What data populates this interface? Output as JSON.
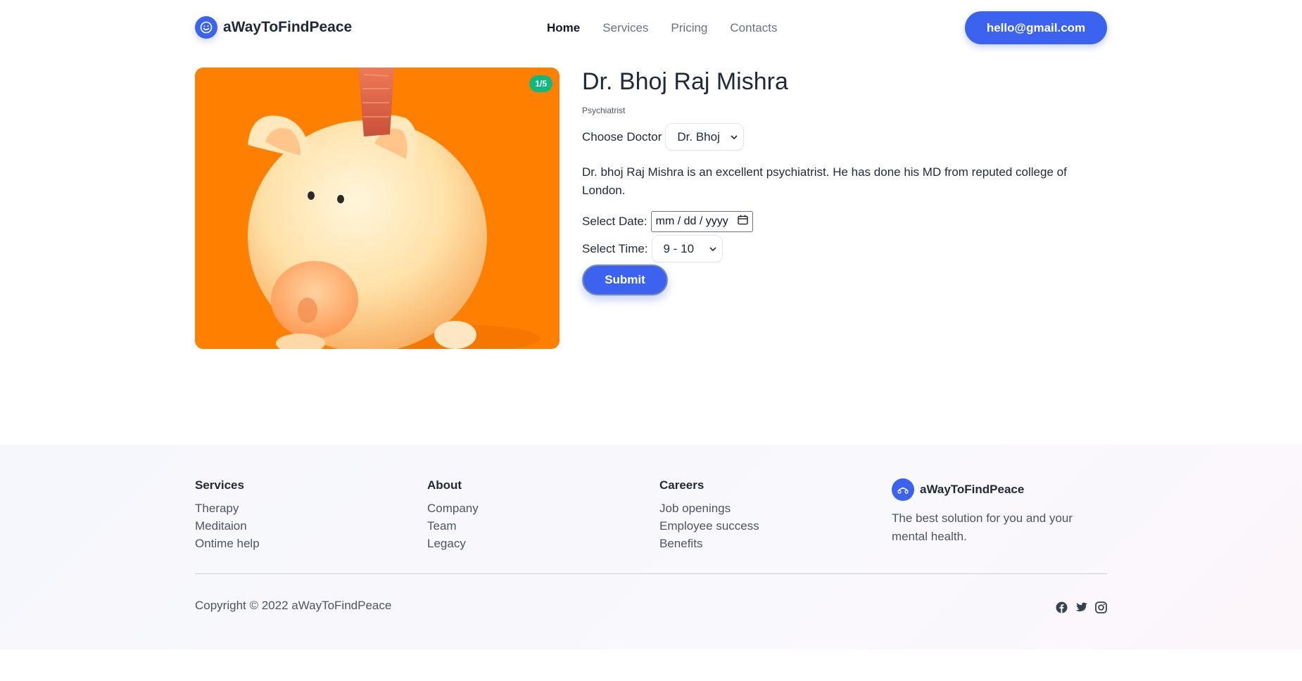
{
  "header": {
    "brand_name": "aWayToFindPeace",
    "nav": [
      {
        "label": "Home",
        "active": true
      },
      {
        "label": "Services",
        "active": false
      },
      {
        "label": "Pricing",
        "active": false
      },
      {
        "label": "Contacts",
        "active": false
      }
    ],
    "email_button": "hello@gmail.com"
  },
  "gallery": {
    "counter": "1/5",
    "image_subject": "piggy-bank"
  },
  "doctor": {
    "name": "Dr. Bhoj Raj Mishra",
    "role": "Psychiatrist",
    "choose_label": "Choose Doctor",
    "selected_doctor": "Dr. Bhoj",
    "description": "Dr. bhoj Raj Mishra is an excellent psychiatrist. He has done his MD from reputed college of London.",
    "date_label": "Select Date:",
    "date_placeholder": "mm / dd / yyyy",
    "time_label": "Select Time:",
    "selected_time": "9 - 10",
    "submit_label": "Submit"
  },
  "footer": {
    "columns": [
      {
        "title": "Services",
        "links": [
          "Therapy",
          "Meditaion",
          "Ontime help"
        ]
      },
      {
        "title": "About",
        "links": [
          "Company",
          "Team",
          "Legacy"
        ]
      },
      {
        "title": "Careers",
        "links": [
          "Job openings",
          "Employee success",
          "Benefits"
        ]
      }
    ],
    "brand_name": "aWayToFindPeace",
    "tagline": "The best solution for you and your mental health.",
    "copyright": "Copyright © 2022 aWayToFindPeace",
    "socials": [
      "facebook-icon",
      "twitter-icon",
      "instagram-icon"
    ]
  },
  "colors": {
    "accent": "#3b63f0",
    "badge": "#10b981",
    "image_background": "#ff8000"
  }
}
